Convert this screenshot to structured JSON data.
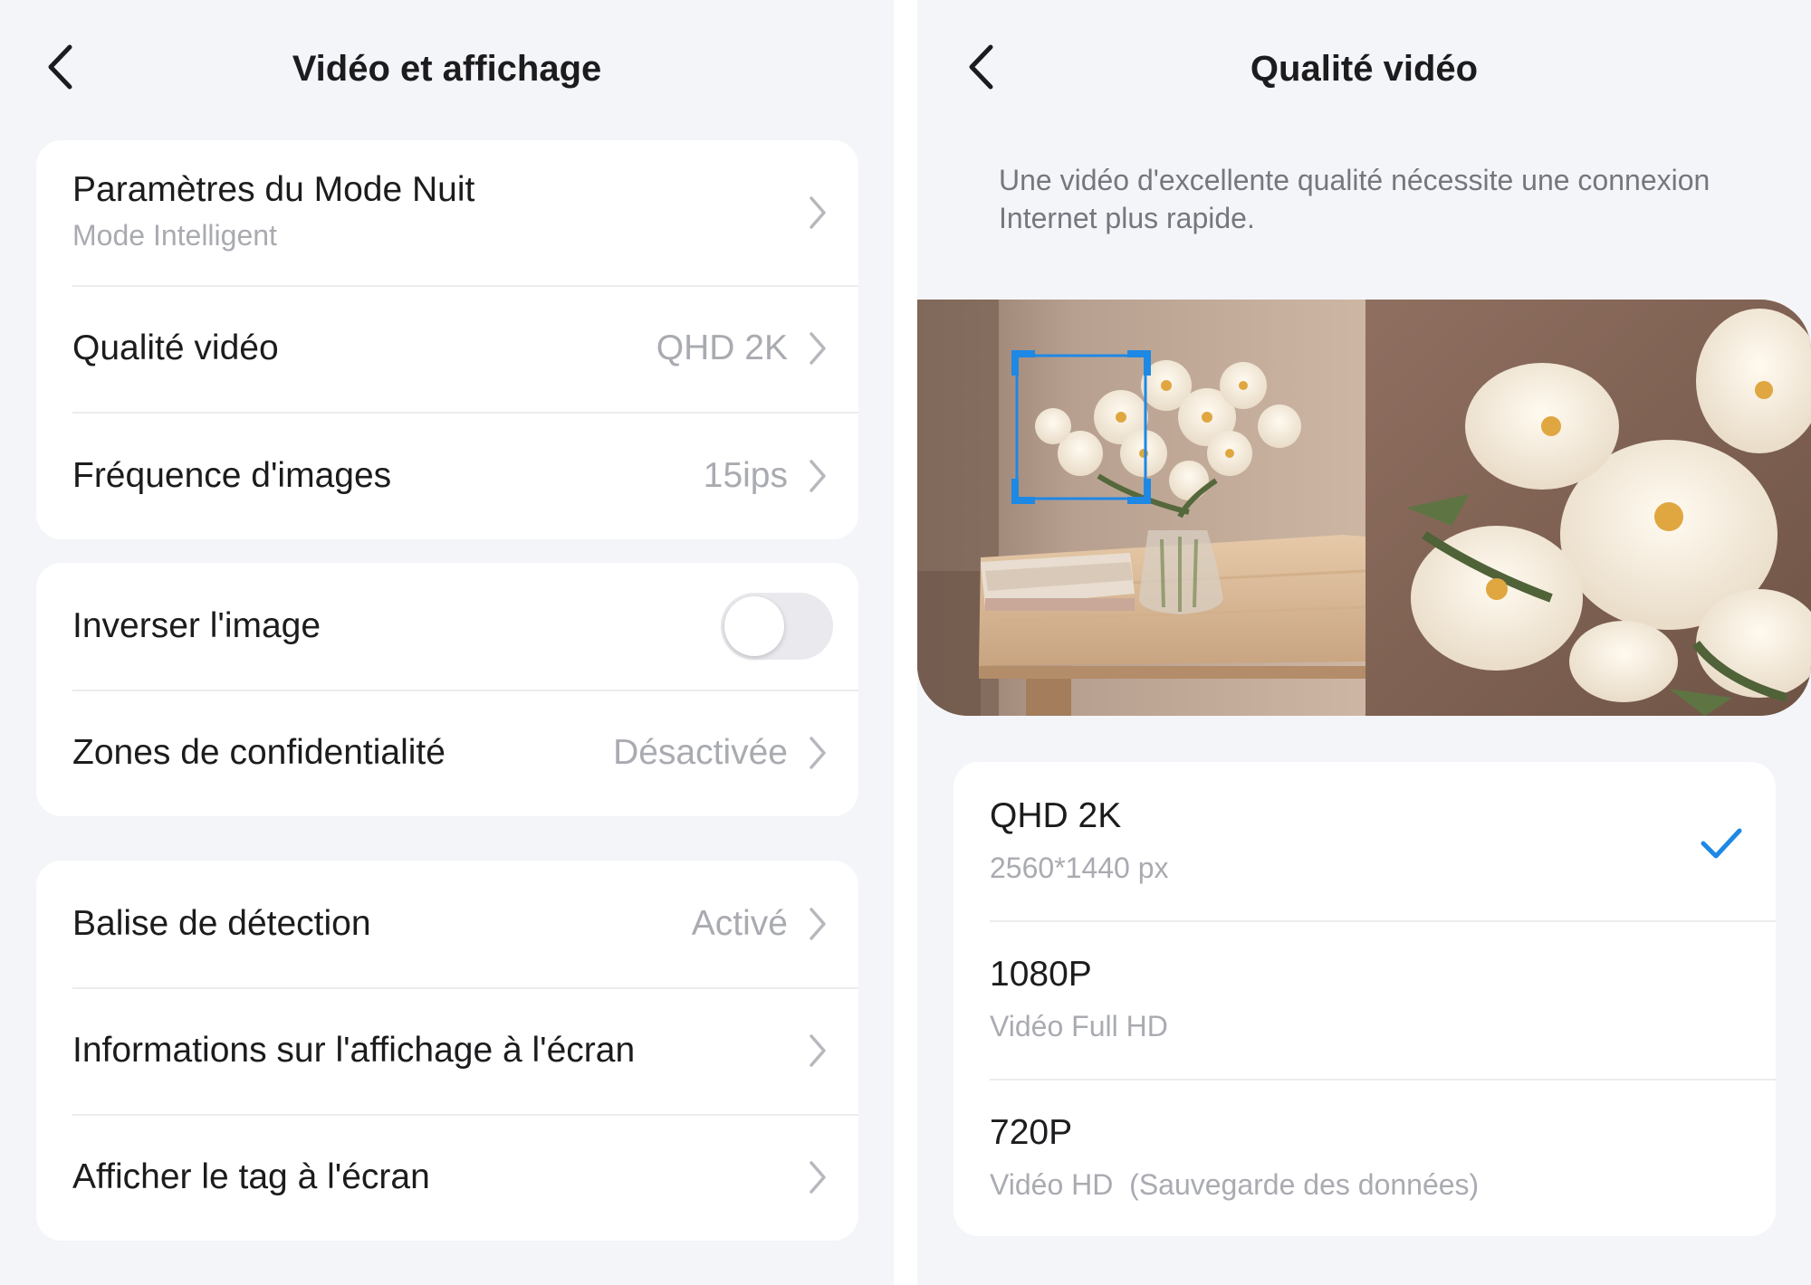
{
  "colors": {
    "background": "#f4f5f9",
    "accent": "#1e88e5",
    "secondary_text": "#a9abb1"
  },
  "left_screen": {
    "title": "Vidéo et affichage",
    "back_icon": "chevron-left-icon",
    "group1": [
      {
        "label": "Paramètres du Mode Nuit",
        "sub": "Mode Intelligent",
        "value": ""
      },
      {
        "label": "Qualité vidéo",
        "value": "QHD 2K"
      },
      {
        "label": "Fréquence d'images",
        "value": "15ips"
      }
    ],
    "group2": {
      "flip": {
        "label": "Inverser l'image",
        "enabled": false
      },
      "privacy": {
        "label": "Zones de confidentialité",
        "value": "Désactivée"
      }
    },
    "group3": [
      {
        "label": "Balise de détection",
        "value": "Activé"
      },
      {
        "label": "Informations sur l'affichage à l'écran",
        "value": ""
      },
      {
        "label": "Afficher le tag à l'écran",
        "value": ""
      }
    ]
  },
  "right_screen": {
    "title": "Qualité vidéo",
    "back_icon": "chevron-left-icon",
    "description": "Une vidéo d'excellente qualité nécessite une connexion Internet plus rapide.",
    "preview_image": "flower-vase-preview-image",
    "options": [
      {
        "title": "QHD 2K",
        "sub": "2560*1440 px",
        "selected": true
      },
      {
        "title": "1080P",
        "sub": "Vidéo Full HD",
        "selected": false
      },
      {
        "title": "720P",
        "sub": "Vidéo HD  (Sauvegarde des données)",
        "selected": false
      }
    ]
  }
}
